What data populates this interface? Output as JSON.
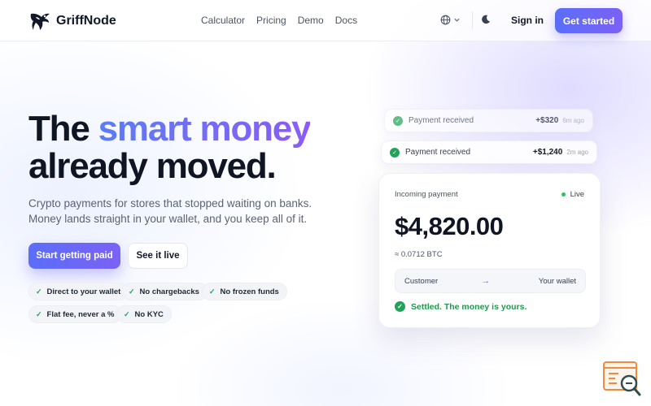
{
  "brand": {
    "name": "GriffNode"
  },
  "nav": {
    "items": [
      "Calculator",
      "Pricing",
      "Demo",
      "Docs"
    ]
  },
  "header": {
    "signin": "Sign in",
    "cta": "Get started"
  },
  "hero": {
    "title_line1_plain": "The",
    "title_line1_accent": "smart money",
    "title_line2": "already moved.",
    "subtitle_line1": "Crypto payments for stores that stopped waiting on banks.",
    "subtitle_line2": "Money lands straight in your wallet, and you keep all of it.",
    "primary_cta": "Start getting paid",
    "secondary_cta": "See it live",
    "check": "✓",
    "features": [
      "Direct to your wallet",
      "No chargebacks",
      "No frozen funds",
      "Flat fee, never a %",
      "No KYC"
    ]
  },
  "notifications": [
    {
      "label": "Payment received",
      "amount": "+$320",
      "ago": "6m ago"
    },
    {
      "label": "Payment received",
      "amount": "+$1,240",
      "ago": "2m ago"
    }
  ],
  "payment_card": {
    "title": "Incoming payment",
    "status": "Live",
    "amount": "$4,820.00",
    "btc": "≈ 0.0712 BTC",
    "from": "Customer",
    "arrow": "→",
    "to": "Your wallet",
    "settled": "Settled. The money is yours."
  },
  "colors": {
    "accent_start": "#5b6ef8",
    "accent_end": "#7b61f5",
    "success": "#22a35a"
  },
  "icons": [
    "griffnode-logo-icon",
    "globe-icon",
    "chevron-down-icon",
    "moon-icon",
    "check-icon",
    "arrow-right-icon",
    "search-code-icon"
  ]
}
